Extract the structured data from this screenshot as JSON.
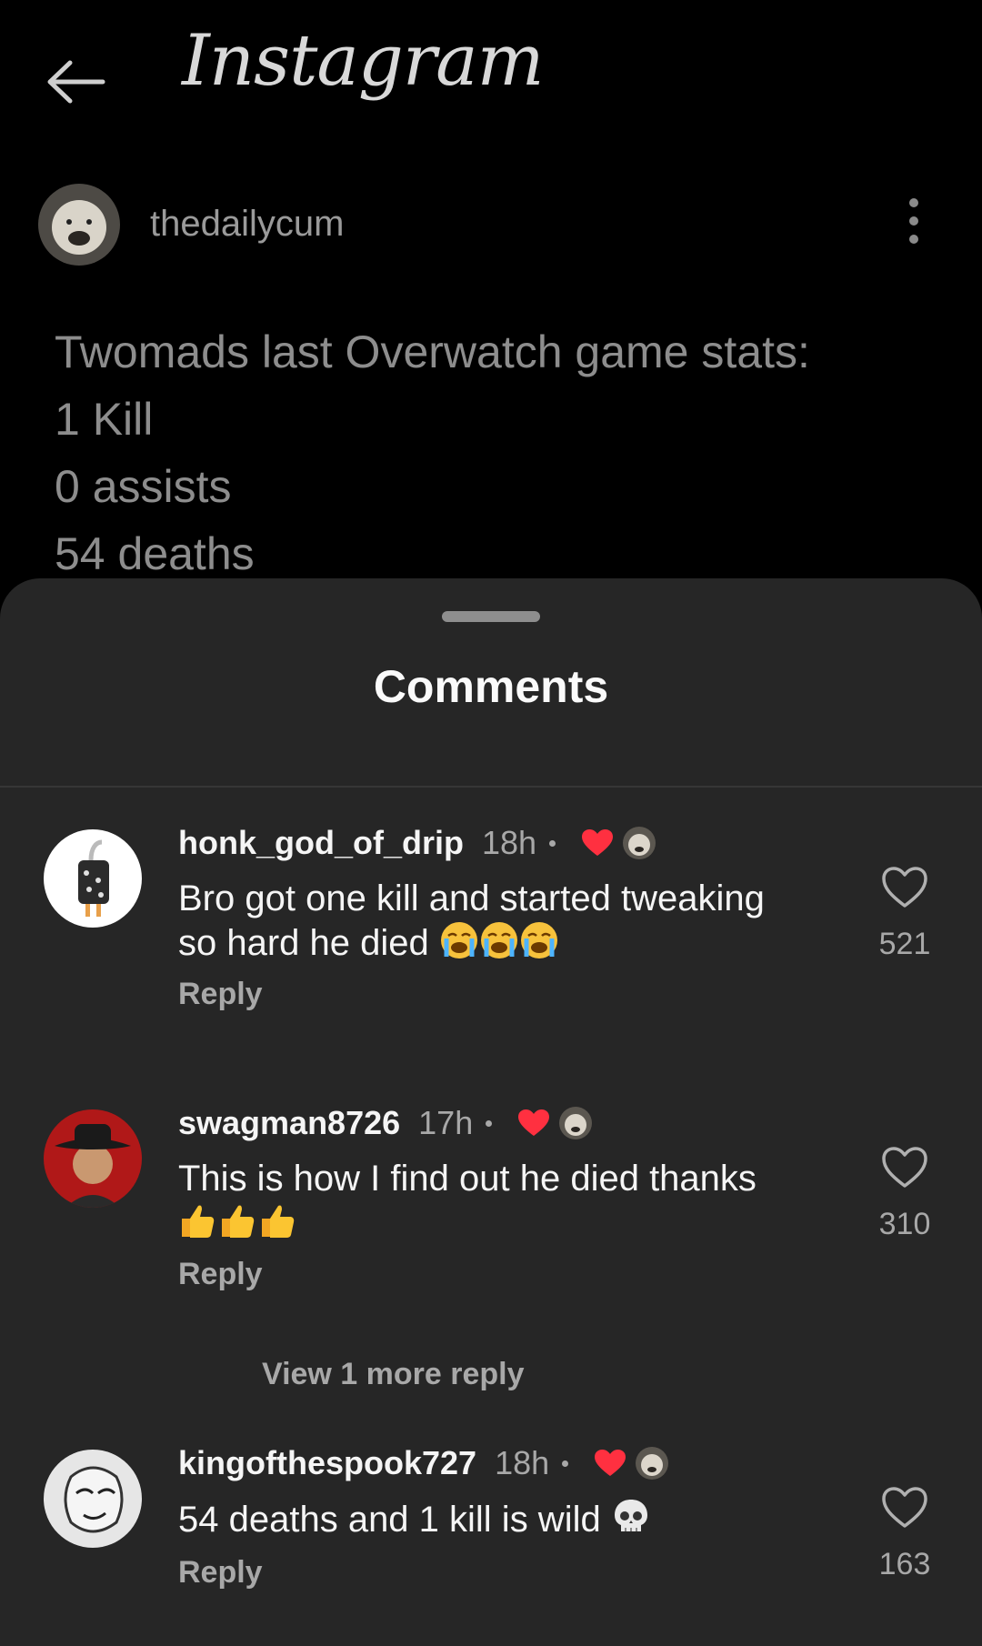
{
  "header": {
    "logo_text": "Instagram",
    "back_icon": "arrow-left-icon"
  },
  "post": {
    "author": "thedailycum",
    "more_icon": "more-vertical-icon",
    "caption_lines": [
      "Twomads last Overwatch game stats:",
      "1 Kill",
      "0 assists",
      "54 deaths"
    ]
  },
  "sheet": {
    "title": "Comments"
  },
  "comments": [
    {
      "username": "honk_god_of_drip",
      "time": "18h",
      "text_lines": [
        "Bro got one kill and started tweaking",
        "so hard he died"
      ],
      "emoji": "loudly-crying-face-icon ×3",
      "reply": "Reply",
      "likes": "521",
      "liked_by_author": true
    },
    {
      "username": "swagman8726",
      "time": "17h",
      "text_lines": [
        "This is how I find out he died thanks"
      ],
      "emoji": "thumbs-up-icon ×3",
      "reply": "Reply",
      "likes": "310",
      "liked_by_author": true,
      "view_more": "View 1 more reply"
    },
    {
      "username": "kingofthespook727",
      "time": "18h",
      "text_lines": [
        "54 deaths and 1 kill is wild"
      ],
      "emoji": "skull-icon",
      "reply": "Reply",
      "likes": "163",
      "liked_by_author": true
    }
  ],
  "colors": {
    "background": "#000000",
    "sheet": "#262626",
    "heart_red": "#ff3040",
    "muted_text": "#a8a8a8"
  }
}
